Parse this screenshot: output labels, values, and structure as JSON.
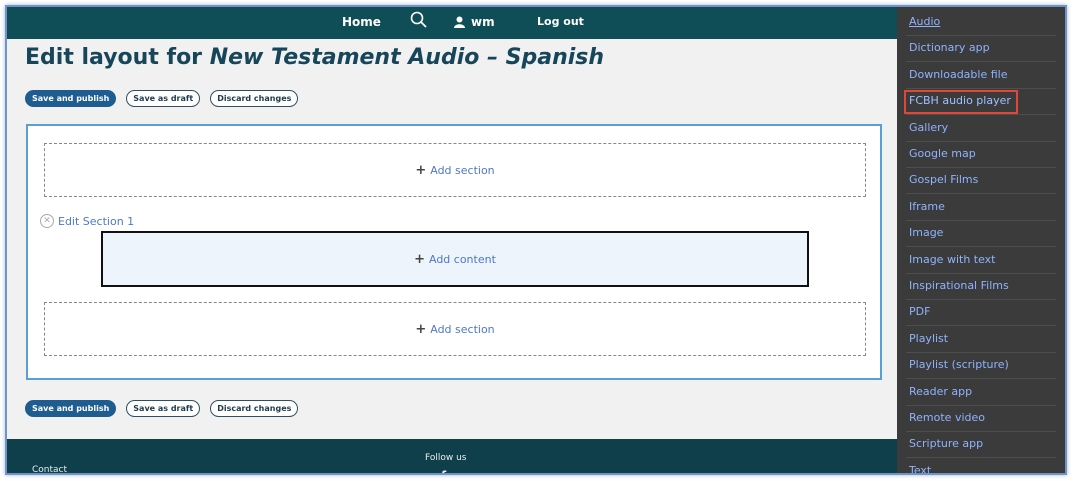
{
  "nav": {
    "home": "Home",
    "user": "wm",
    "logout": "Log out"
  },
  "page": {
    "title_prefix": "Edit layout for ",
    "title_italic": "New Testament Audio – Spanish"
  },
  "actions": {
    "save_publish": "Save and publish",
    "save_draft": "Save as draft",
    "discard": "Discard changes"
  },
  "layout": {
    "add_section": "Add section",
    "edit_section": "Edit Section 1",
    "add_content": "Add content"
  },
  "footer": {
    "follow": "Follow us",
    "contact": "Contact",
    "social_icon": "f"
  },
  "sidebar": {
    "items": [
      {
        "label": "Audio"
      },
      {
        "label": "Dictionary app"
      },
      {
        "label": "Downloadable file"
      },
      {
        "label": "FCBH audio player"
      },
      {
        "label": "Gallery"
      },
      {
        "label": "Google map"
      },
      {
        "label": "Gospel Films"
      },
      {
        "label": "Iframe"
      },
      {
        "label": "Image"
      },
      {
        "label": "Image with text"
      },
      {
        "label": "Inspirational Films"
      },
      {
        "label": "PDF"
      },
      {
        "label": "Playlist"
      },
      {
        "label": "Playlist (scripture)"
      },
      {
        "label": "Reader app"
      },
      {
        "label": "Remote video"
      },
      {
        "label": "Scripture app"
      },
      {
        "label": "Text"
      }
    ],
    "highlighted": "FCBH audio player"
  },
  "colors": {
    "topbar": "#0f4e56",
    "sidebar": "#3b3b3b",
    "link": "#8fb3ff",
    "highlight": "#e2453a",
    "primary_button": "#1f5c8f"
  }
}
